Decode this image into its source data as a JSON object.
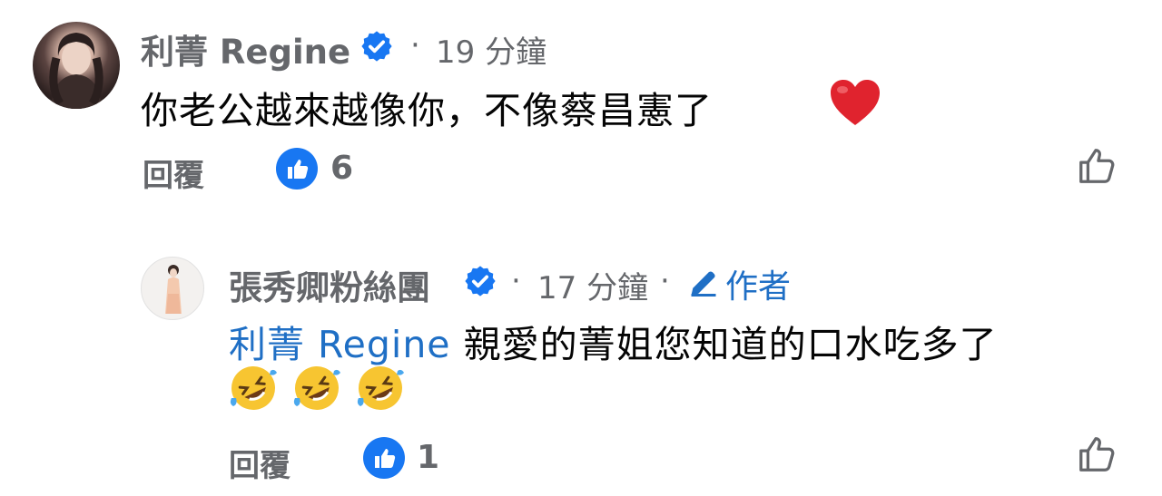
{
  "comment": {
    "author": "利菁 Regine",
    "time": "19 分鐘",
    "text": "你老公越來越像你，不像蔡昌憲了",
    "reply_label": "回覆",
    "like_count": "6",
    "heart_emoji": "heart-emoji"
  },
  "reply": {
    "author": "張秀卿粉絲團",
    "time": "17 分鐘",
    "author_badge": "作者",
    "mention": "利菁 Regine",
    "text": "親愛的菁姐您知道的口水吃多了",
    "reply_label": "回覆",
    "like_count": "1",
    "emojis": [
      "rolling-on-floor-laughing-emoji",
      "rolling-on-floor-laughing-emoji",
      "rolling-on-floor-laughing-emoji"
    ]
  },
  "colors": {
    "facebook_blue": "#1877f2",
    "mention_blue": "#1f6fc5",
    "secondary_text": "#65676b",
    "primary_text": "#050505",
    "heart_red": "#e0232e"
  }
}
